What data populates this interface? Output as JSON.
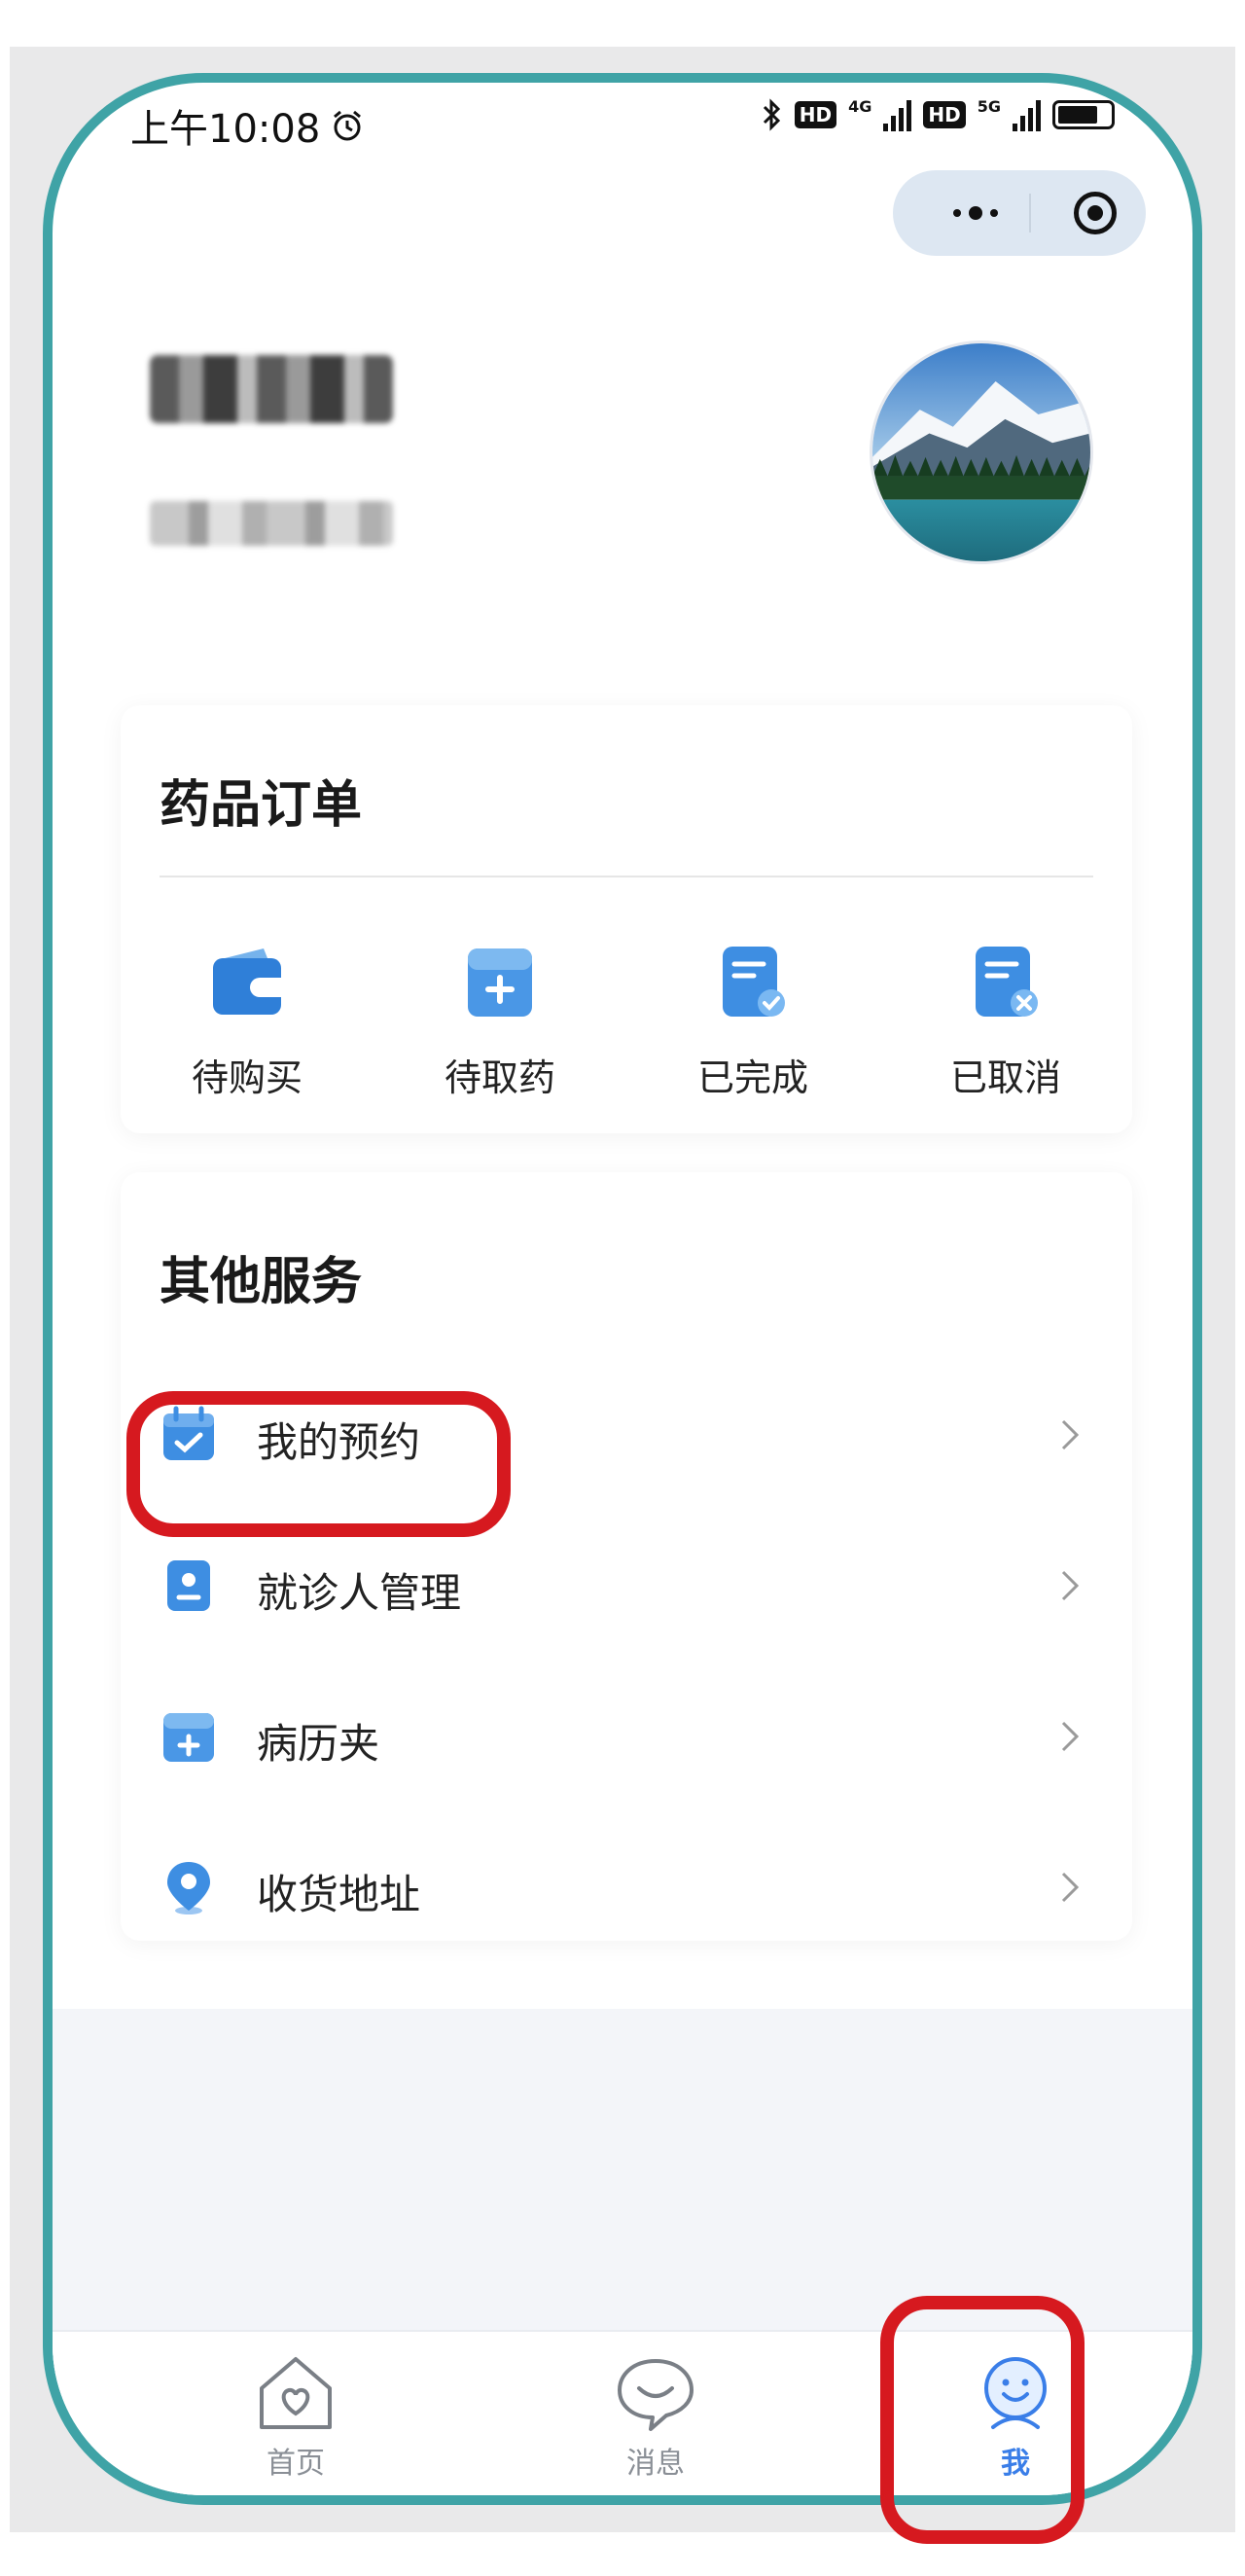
{
  "status_bar": {
    "time": "上午10:08",
    "alarm_icon": "alarm-icon",
    "network": "4G",
    "network2": "5G",
    "hd": "HD",
    "battery": "81"
  },
  "capsule": {
    "more_icon": "more-dots-icon",
    "close_icon": "target-circle-icon"
  },
  "profile": {
    "avatar_icon": "mountain-lake-avatar"
  },
  "orders": {
    "title": "药品订单",
    "items": [
      {
        "label": "待购买",
        "icon": "wallet-icon"
      },
      {
        "label": "待取药",
        "icon": "medicine-box-icon"
      },
      {
        "label": "已完成",
        "icon": "document-check-icon"
      },
      {
        "label": "已取消",
        "icon": "document-cancel-icon"
      }
    ]
  },
  "services": {
    "title": "其他服务",
    "items": [
      {
        "label": "我的预约",
        "icon": "calendar-check-icon"
      },
      {
        "label": "就诊人管理",
        "icon": "id-card-icon"
      },
      {
        "label": "病历夹",
        "icon": "folder-plus-icon"
      },
      {
        "label": "收货地址",
        "icon": "location-pin-icon"
      }
    ]
  },
  "tabbar": {
    "items": [
      {
        "label": "首页",
        "icon": "home-heart-icon",
        "active": false
      },
      {
        "label": "消息",
        "icon": "chat-bubble-icon",
        "active": false
      },
      {
        "label": "我",
        "icon": "smiley-face-icon",
        "active": true
      }
    ]
  },
  "colors": {
    "accent": "#3a7ee8",
    "icon_blue": "#2f7fd8",
    "highlight_red": "#d6191f",
    "frame_teal": "#3fa3a6"
  }
}
